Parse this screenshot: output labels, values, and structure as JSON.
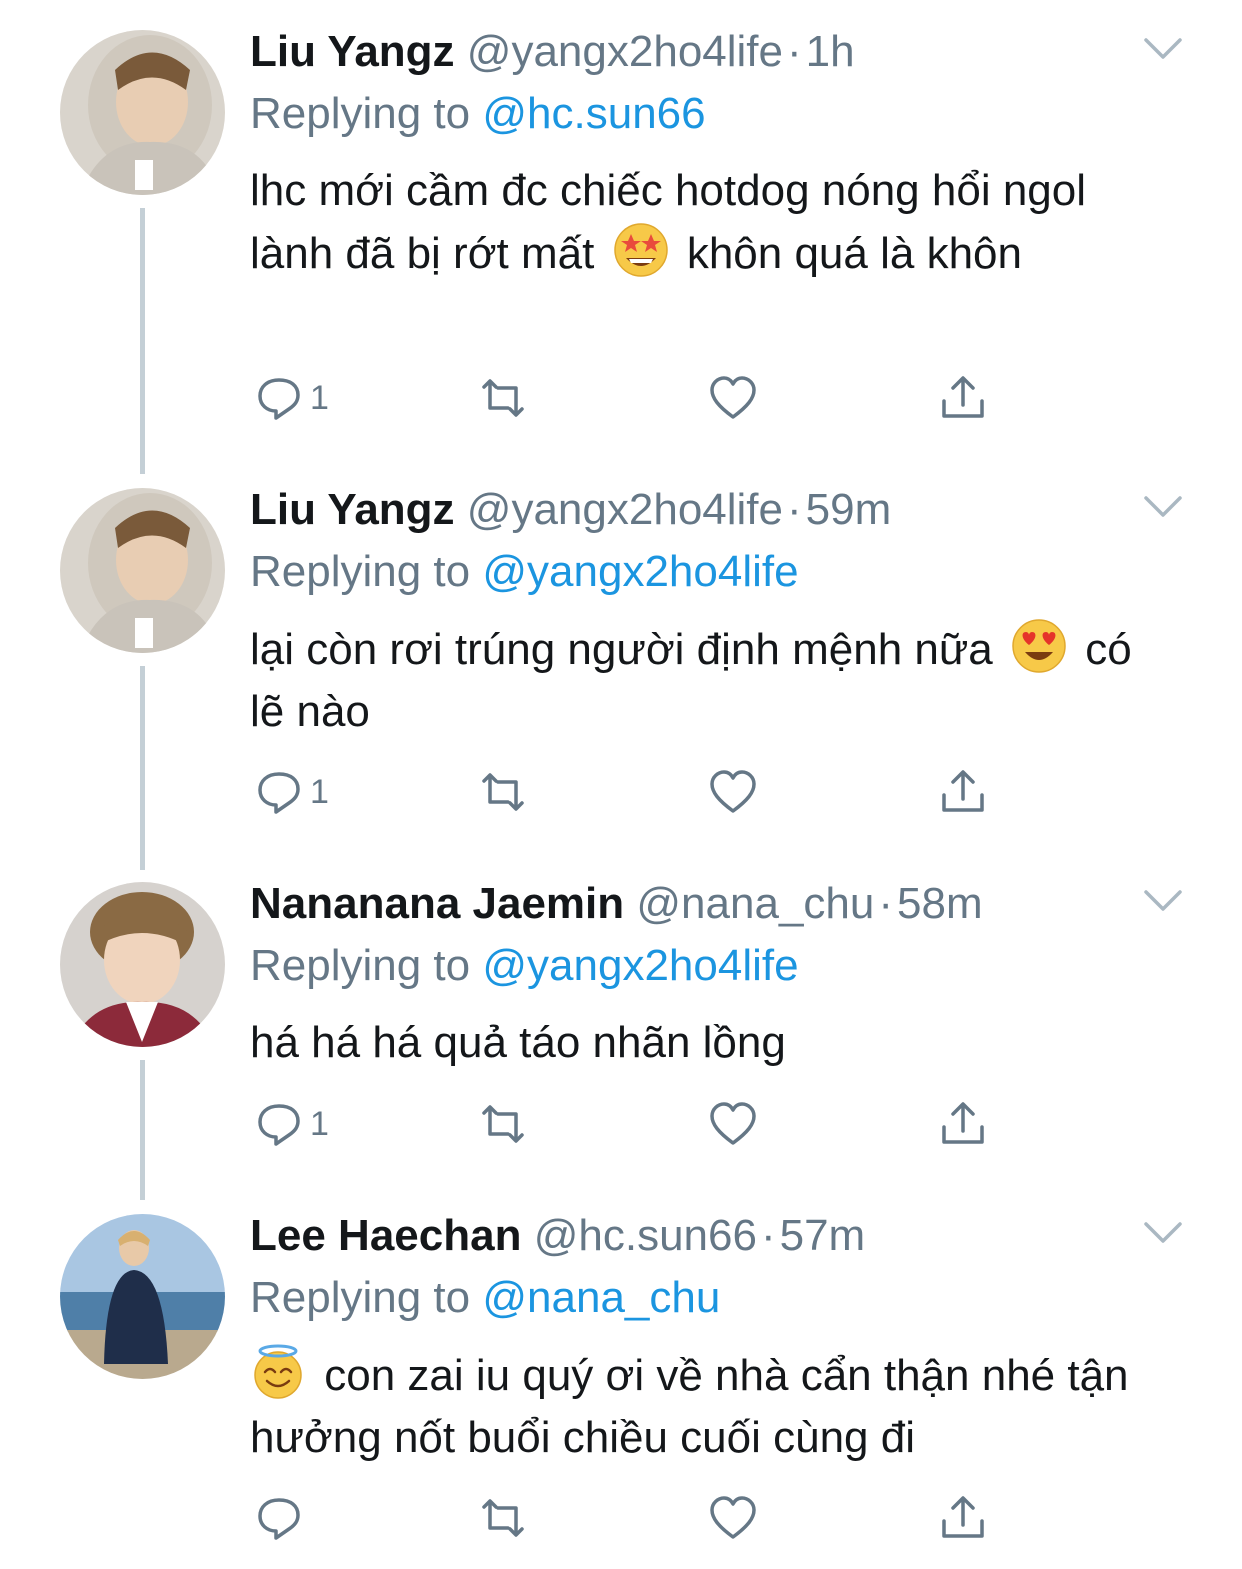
{
  "colors": {
    "name": "#14171a",
    "muted": "#657786",
    "link": "#1b95e0",
    "thread_line": "#c4cfd6"
  },
  "tweets": [
    {
      "name": "Liu Yangz",
      "handle": "@yangx2ho4life",
      "separator": "·",
      "time": "1h",
      "replying_label": "Replying to",
      "replying_to": "@hc.sun66",
      "text_before_emoji": "lhc mới cầm đc chiếc hotdog nóng hổi ngol lành đã bị rớt mất",
      "emoji": "star-struck-emoji",
      "text_after_emoji": "khôn quá là khôn",
      "reply_count": "1"
    },
    {
      "name": "Liu Yangz",
      "handle": "@yangx2ho4life",
      "separator": "·",
      "time": "59m",
      "replying_label": "Replying to",
      "replying_to": "@yangx2ho4life",
      "text_before_emoji": "lại còn rơi trúng người định mệnh nữa",
      "emoji": "heart-eyes-emoji",
      "text_after_emoji": "có lẽ nào",
      "reply_count": "1"
    },
    {
      "name": "Nananana Jaemin",
      "handle": "@nana_chu",
      "separator": "·",
      "time": "58m",
      "replying_label": "Replying to",
      "replying_to": "@yangx2ho4life",
      "text": "há há há quả táo nhãn lồng",
      "reply_count": "1"
    },
    {
      "name": "Lee Haechan",
      "handle": "@hc.sun66",
      "separator": "·",
      "time": "57m",
      "replying_label": "Replying to",
      "replying_to": "@nana_chu",
      "emoji": "halo-emoji",
      "text_after_emoji": "con zai iu quý ơi về nhà cẩn thận nhé tận hưởng nốt buổi chiều cuối cùng đi",
      "reply_count": ""
    }
  ]
}
